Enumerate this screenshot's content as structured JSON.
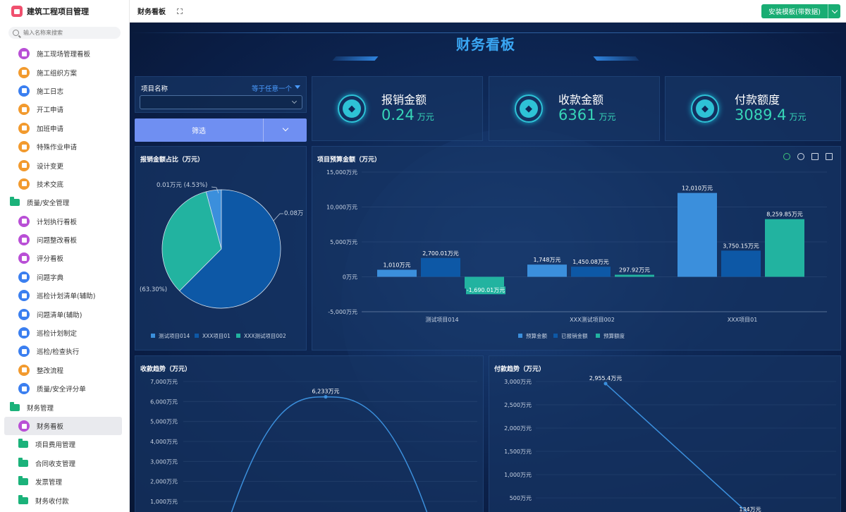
{
  "app": {
    "title": "建筑工程项目管理"
  },
  "search": {
    "placeholder": "输入名称来搜索"
  },
  "sidebar": {
    "items": [
      {
        "label": "施工现场管理看板",
        "icon": "purple",
        "type": "item"
      },
      {
        "label": "施工组织方案",
        "icon": "orange",
        "type": "item"
      },
      {
        "label": "施工日志",
        "icon": "blue",
        "type": "item"
      },
      {
        "label": "开工申请",
        "icon": "orange",
        "type": "item"
      },
      {
        "label": "加班申请",
        "icon": "orange",
        "type": "item"
      },
      {
        "label": "特殊作业申请",
        "icon": "orange",
        "type": "item"
      },
      {
        "label": "设计变更",
        "icon": "orange",
        "type": "item"
      },
      {
        "label": "技术交底",
        "icon": "orange",
        "type": "item"
      },
      {
        "label": "质量/安全管理",
        "icon": "folder",
        "type": "group"
      },
      {
        "label": "计划执行看板",
        "icon": "purple",
        "type": "item"
      },
      {
        "label": "问题整改看板",
        "icon": "purple",
        "type": "item"
      },
      {
        "label": "评分看板",
        "icon": "purple",
        "type": "item"
      },
      {
        "label": "问题字典",
        "icon": "blue",
        "type": "item"
      },
      {
        "label": "巡检计划清单(辅助)",
        "icon": "blue",
        "type": "item"
      },
      {
        "label": "问题清单(辅助)",
        "icon": "blue",
        "type": "item"
      },
      {
        "label": "巡检计划制定",
        "icon": "blue",
        "type": "item"
      },
      {
        "label": "巡检/检查执行",
        "icon": "blue",
        "type": "item"
      },
      {
        "label": "整改流程",
        "icon": "orange",
        "type": "item"
      },
      {
        "label": "质量/安全评分单",
        "icon": "blue",
        "type": "item"
      },
      {
        "label": "财务管理",
        "icon": "folder",
        "type": "group"
      },
      {
        "label": "财务看板",
        "icon": "purple",
        "type": "item",
        "active": true
      },
      {
        "label": "项目费用管理",
        "icon": "folder",
        "type": "item"
      },
      {
        "label": "合同收支管理",
        "icon": "folder",
        "type": "item"
      },
      {
        "label": "发票管理",
        "icon": "folder",
        "type": "item"
      },
      {
        "label": "财务收付款",
        "icon": "folder",
        "type": "item"
      }
    ]
  },
  "topbar": {
    "page_title": "财务看板",
    "install_button": "安装模板(带数据)"
  },
  "dashboard": {
    "title": "财务看板",
    "filter": {
      "label": "项目名称",
      "operator": "等于任意一个",
      "button": "筛选"
    },
    "kpis": [
      {
        "label": "报销金额",
        "value": "0.24",
        "unit": "万元"
      },
      {
        "label": "收款金额",
        "value": "6361",
        "unit": "万元"
      },
      {
        "label": "付款额度",
        "value": "3089.4",
        "unit": "万元"
      }
    ]
  },
  "chart_data": [
    {
      "type": "pie",
      "title": "报销金额占比（万元）",
      "labels": [
        "测试项目014",
        "XXX项目01",
        "XXX测试项目002"
      ],
      "values": [
        0.01,
        0.15,
        0.08
      ],
      "value_labels": [
        "0.01万元 (4.53%)",
        "(63.30%)",
        "0.08万"
      ],
      "colors": [
        "#3b8fdc",
        "#0d58a6",
        "#22b3a0"
      ],
      "legend": "bottom"
    },
    {
      "type": "bar",
      "title": "项目预算金额（万元）",
      "categories": [
        "测试项目014",
        "XXX测试项目002",
        "XXX项目01"
      ],
      "series": [
        {
          "name": "预算金额",
          "values": [
            1010,
            1748,
            12010
          ],
          "labels": [
            "1,010万元",
            "1,748万元",
            "12,010万元"
          ],
          "color": "#3b8fdc"
        },
        {
          "name": "已报销金额",
          "values": [
            2700.01,
            1450.08,
            3750.15
          ],
          "labels": [
            "2,700.01万元",
            "1,450.08万元",
            "3,750.15万元"
          ],
          "color": "#0d58a6"
        },
        {
          "name": "预算额度",
          "values": [
            -1690.01,
            297.92,
            8259.85
          ],
          "labels": [
            "-1,690.01万元",
            "297.92万元",
            "8,259.85万元"
          ],
          "color": "#22b3a0"
        }
      ],
      "yticks": [
        "15,000万元",
        "10,000万元",
        "5,000万元",
        "0万元",
        "-5,000万元"
      ],
      "ylim": [
        -5000,
        15000
      ],
      "legend": "bottom"
    },
    {
      "type": "line",
      "title": "收款趋势（万元）",
      "yticks": [
        "7,000万元",
        "6,000万元",
        "5,000万元",
        "4,000万元",
        "3,000万元",
        "2,000万元",
        "1,000万元"
      ],
      "ylim": [
        1000,
        7000
      ],
      "peak": {
        "value": 6233,
        "label": "6,233万元"
      }
    },
    {
      "type": "line",
      "title": "付款趋势（万元）",
      "yticks": [
        "3,000万元",
        "2,500万元",
        "2,000万元",
        "1,500万元",
        "1,000万元",
        "500万元"
      ],
      "ylim": [
        500,
        3000
      ],
      "points": [
        {
          "value": 2955.4,
          "label": "2,955.4万元"
        },
        {
          "value": 134,
          "label": "134万元"
        }
      ]
    }
  ]
}
